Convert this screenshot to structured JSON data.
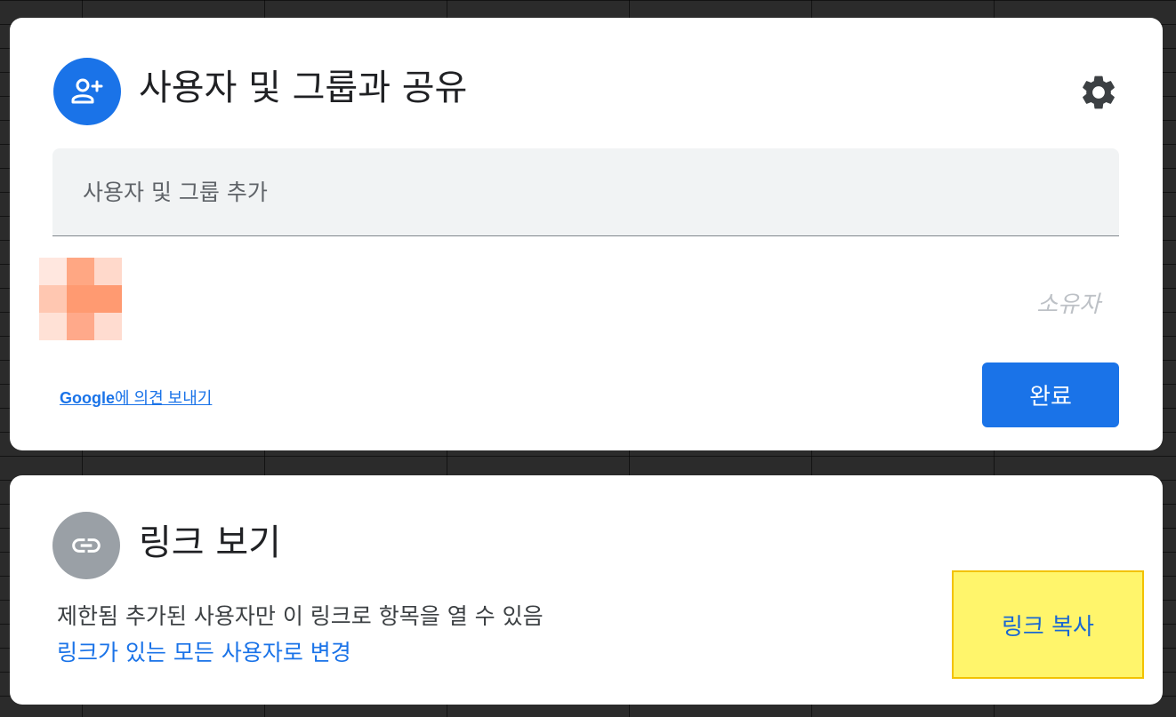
{
  "share": {
    "title": "사용자 및 그룹과 공유",
    "icon": "person-add-icon",
    "settings_icon": "gear-icon",
    "add_placeholder": "사용자 및 그룹 추가",
    "add_value": "",
    "owner_label": "소유자",
    "feedback_google": "Google",
    "feedback_rest": "에 의견 보내기",
    "done_label": "완료",
    "avatar_colors": [
      "#ffe7df",
      "#ffa783",
      "#ffd9cb",
      "#ffc7b1",
      "#ff9a71",
      "#ff9a71",
      "#ffe1d6",
      "#ffa98a",
      "#ffdcd0"
    ]
  },
  "link": {
    "title": "링크 보기",
    "icon": "link-icon",
    "restriction_bold": "제한됨",
    "restriction_desc": " 추가된 사용자만 이 링크로 항목을 열 수 있음",
    "change_label": "링크가 있는 모든 사용자로 변경",
    "copy_label": "링크 복사"
  },
  "colors": {
    "accent": "#1a73e8",
    "highlight": "#fff56b",
    "highlight_border": "#f2c200",
    "neutral_icon_bg": "#9aa0a6"
  }
}
